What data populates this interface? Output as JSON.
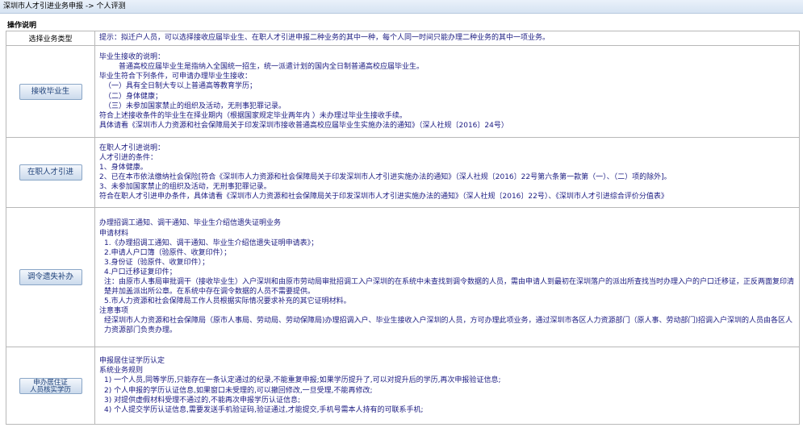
{
  "header": {
    "breadcrumb": "深圳市人才引进业务申报 -> 个人评测"
  },
  "ops_title": "操作说明",
  "select_row": {
    "label": "选择业务类型",
    "tip": "提示：拟迁户人员，可以选择接收应届毕业生、在职人才引进申报二种业务的其中一种，每个人同一时间只能办理二种业务的其中一项业务。"
  },
  "sections": [
    {
      "button": "接收毕业生",
      "lines": [
        "毕业生接收的说明：",
        "普通高校应届毕业生是指纳入全国统一招生，统一派遣计划的国内全日制普通高校应届毕业生。",
        "毕业生符合下列条件，可申请办理毕业生接收：",
        "（一）具有全日制大专以上普通高等教育学历；",
        "（二）身体健康；",
        "（三）未参加国家禁止的组织及活动，无刑事犯罪记录。",
        "符合上述接收条件的毕业生在择业期内（根据国家规定毕业两年内 ）未办理过毕业生接收手续。",
        "具体请看《深圳市人力资源和社会保障局关于印发深圳市接收普通高校应届毕业生实施办法的通知》（深人社规〔2016〕24号）"
      ]
    },
    {
      "button": "在职人才引进",
      "lines": [
        "在职人才引进说明：",
        "人才引进的条件：",
        "1、身体健康。",
        "2、已在本市依法缴纳社会保险[符合《深圳市人力资源和社会保障局关于印发深圳市人才引进实施办法的通知》（深人社规〔2016〕22号第六条第一款第（一）、（二）项的除外]。",
        "3、未参加国家禁止的组织及活动，无刑事犯罪记录。",
        "符合在职人才引进申办条件，具体请看《深圳市人力资源和社会保障局关于印发深圳市人才引进实施办法的通知》（深人社规〔2016〕22号）、《深圳市人才引进综合评价分值表》"
      ]
    },
    {
      "button": "调令遗失补办",
      "lines": [
        "办理招调工通知、调干通知、毕业生介绍信遗失证明业务",
        "申请材料",
        "1.《办理招调工通知、调干通知、毕业生介绍信遗失证明申请表》；",
        "2.申请人户口簿（验原件、收复印件）；",
        "3.身份证（验原件、收复印件）；",
        "4.户口迁移证复印件；",
        "注：由原市人事局审批调干（接收毕业生）入户深圳和由原市劳动局审批招调工入户深圳的在系统中未查找到调令数据的人员，需由申请人到最初在深圳落户的派出所查找当时办理入户的户口迁移证，正反两面复印清楚并加盖派出所公章。在系统中存在调令数据的人员不需要提供。",
        "5.市人力资源和社会保障局工作人员根据实际情况要求补充的其它证明材料。",
        "注意事项",
        "经深圳市人力资源和社会保障局（原市人事局、劳动局、劳动保障局)办理招调入户、毕业生接收入户深圳的人员，方可办理此项业务，通过深圳市各区人力资源部门（原人事、劳动部门)招调入户深圳的人员由各区人力资源部门负责办理。"
      ]
    },
    {
      "button_line1": "申办居住证",
      "button_line2": "人员核实学历",
      "lines": [
        "申报居住证学历认定",
        "系统业务规则",
        "1) 一个人员,同等学历,只能存在一条认定通过的纪录,不能重复申报;如果学历提升了,可以对提升后的学历,再次申报验证信息;",
        "2) 个人申报的学历认证信息,如果窗口未受理的,可以撤回修改,一旦受理,不能再修改;",
        "3) 对提供虚假材料受理不通过的,不能再次申报学历认证信息;",
        "4) 个人提交学历认证信息,需要发送手机验证码,验证通过,才能提交,手机号需本人持有的可联系手机;"
      ]
    }
  ]
}
